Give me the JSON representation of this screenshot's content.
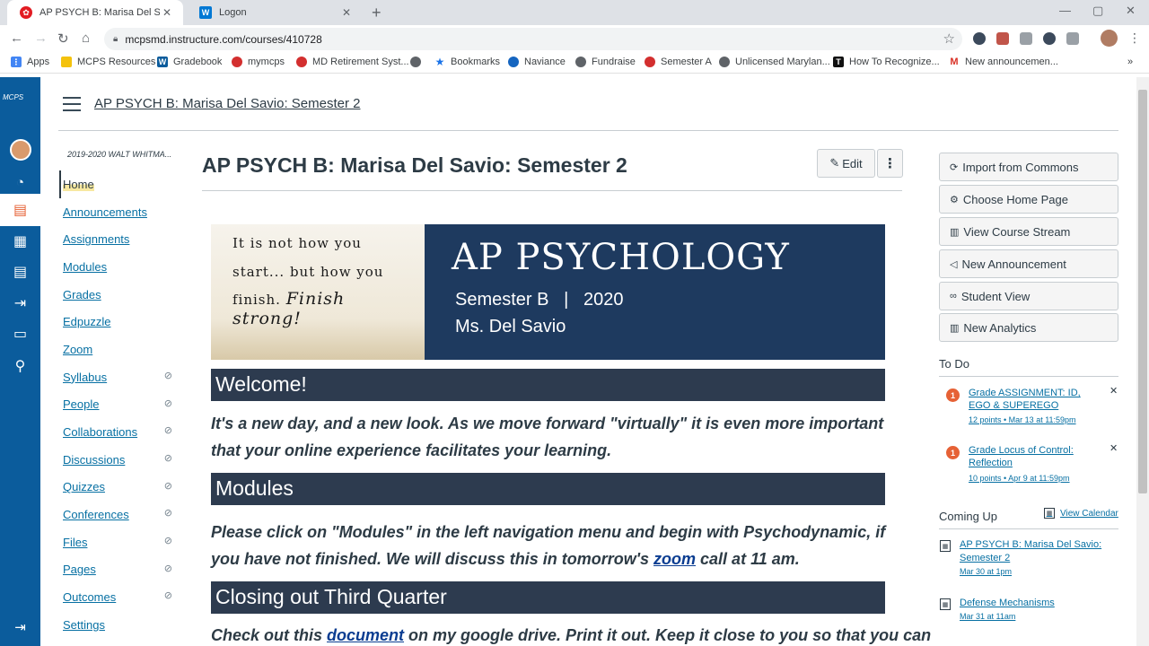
{
  "browser": {
    "tabs": [
      {
        "title": "AP PSYCH B: Marisa Del Savio: Se",
        "favicon_color": "#e21c23"
      },
      {
        "title": "Logon",
        "favicon_color": "#0078d4"
      }
    ],
    "url": "mcpsmd.instructure.com/courses/410728",
    "bookmarks": [
      {
        "label": "Apps",
        "color": "#4285f4"
      },
      {
        "label": "MCPS Resources",
        "color": "#f4c20d"
      },
      {
        "label": "Gradebook",
        "color": "#0b5c9c"
      },
      {
        "label": "mymcps",
        "color": "#d32f2f"
      },
      {
        "label": "MD Retirement Syst...",
        "color": "#d32f2f"
      },
      {
        "label": "",
        "color": "#5f6368"
      },
      {
        "label": "Bookmarks",
        "color": "#1a73e8"
      },
      {
        "label": "Naviance",
        "color": "#1565c0"
      },
      {
        "label": "Fundraise",
        "color": "#5f6368"
      },
      {
        "label": "Semester A",
        "color": "#d32f2f"
      },
      {
        "label": "Unlicensed Marylan...",
        "color": "#5f6368"
      },
      {
        "label": "How To Recognize...",
        "color": "#111111"
      },
      {
        "label": "New announcemen...",
        "color": "#d93025"
      }
    ]
  },
  "global_nav": {
    "logo": "MCPS",
    "items": [
      "account",
      "dashboard",
      "courses",
      "calendar",
      "inbox",
      "commons",
      "files",
      "help"
    ]
  },
  "header": {
    "breadcrumb": "AP PSYCH B: Marisa Del Savio: Semester 2"
  },
  "course_nav": {
    "term": "2019-2020 WALT WHITMA...",
    "items": [
      {
        "label": "Home",
        "hidden": false,
        "active": true
      },
      {
        "label": "Announcements",
        "hidden": false
      },
      {
        "label": "Assignments",
        "hidden": false
      },
      {
        "label": "Modules",
        "hidden": false
      },
      {
        "label": "Grades",
        "hidden": false
      },
      {
        "label": "Edpuzzle",
        "hidden": false
      },
      {
        "label": "Zoom",
        "hidden": false
      },
      {
        "label": "Syllabus",
        "hidden": true
      },
      {
        "label": "People",
        "hidden": true
      },
      {
        "label": "Collaborations",
        "hidden": true
      },
      {
        "label": "Discussions",
        "hidden": true
      },
      {
        "label": "Quizzes",
        "hidden": true
      },
      {
        "label": "Conferences",
        "hidden": true
      },
      {
        "label": "Files",
        "hidden": true
      },
      {
        "label": "Pages",
        "hidden": true
      },
      {
        "label": "Outcomes",
        "hidden": true
      },
      {
        "label": "Settings",
        "hidden": false
      }
    ]
  },
  "main": {
    "title": "AP PSYCH B: Marisa Del Savio: Semester 2",
    "edit_label": "Edit",
    "banner": {
      "quote_line1": "It is not how you",
      "quote_line2": "start... but how you",
      "quote_line3": "finish.",
      "quote_script": "Finish strong!",
      "title": "AP PSYCHOLOGY",
      "subtitle": "Semester B   |   2020",
      "teacher": "Ms. Del Savio"
    },
    "sections": [
      {
        "heading": "Welcome!"
      },
      {
        "heading": "Modules"
      },
      {
        "heading": "Closing out Third Quarter"
      }
    ],
    "welcome_text": "It's a new day, and a new look. As we move forward \"virtually\" it is even more important that your online experience facilitates your learning.",
    "modules_text_before": "Please click on \"Modules\" in the left navigation menu and begin with Psychodynamic, if you have not finished. We will discuss this in tomorrow's ",
    "modules_link": "zoom",
    "modules_text_after": " call at 11 am.",
    "closing_text_before": "Check out this ",
    "closing_link": "document",
    "closing_text_after": " on my google drive. Print it out. Keep it close to you so that you can"
  },
  "sidebar": {
    "buttons": [
      {
        "label": "Import from Commons",
        "icon": "commons-icon"
      },
      {
        "label": "Choose Home Page",
        "icon": "gear-icon"
      },
      {
        "label": "View Course Stream",
        "icon": "stream-icon"
      },
      {
        "label": "New Announcement",
        "icon": "megaphone-icon"
      },
      {
        "label": "Student View",
        "icon": "glasses-icon"
      },
      {
        "label": "New Analytics",
        "icon": "analytics-icon"
      }
    ],
    "todo_heading": "To Do",
    "todo": [
      {
        "count": "1",
        "title": "Grade ASSIGNMENT: ID, EGO & SUPEREGO",
        "meta": "12 points • Mar 13 at 11:59pm"
      },
      {
        "count": "1",
        "title": "Grade Locus of Control: Reflection",
        "meta": "10 points • Apr 9 at 11:59pm"
      }
    ],
    "coming_up_heading": "Coming Up",
    "view_calendar": "View Calendar",
    "coming_up": [
      {
        "title": "AP PSYCH B: Marisa Del Savio: Semester 2",
        "meta": "Mar 30 at 1pm"
      },
      {
        "title": "Defense Mechanisms",
        "meta": "Mar 31 at 11am"
      }
    ]
  }
}
